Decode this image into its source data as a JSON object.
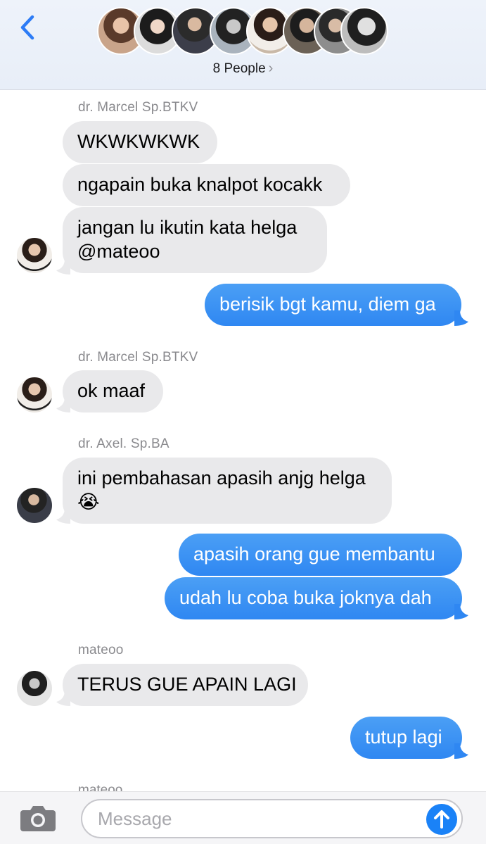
{
  "header": {
    "group_label": "8 People",
    "back_icon": "chevron-left-icon",
    "accent": "#2d7cf6"
  },
  "messages": [
    {
      "sender": "dr. Marcel Sp.BTKV",
      "direction": "in",
      "lines": [
        "WKWKWKWK"
      ]
    },
    {
      "direction": "in",
      "lines": [
        "ngapain buka knalpot kocakk"
      ]
    },
    {
      "direction": "in",
      "lines": [
        "jangan lu ikutin kata helga",
        "@mateoo"
      ]
    },
    {
      "direction": "out",
      "lines": [
        "berisik bgt kamu, diem ga"
      ]
    },
    {
      "sender": "dr. Marcel Sp.BTKV",
      "direction": "in",
      "lines": [
        "ok maaf"
      ]
    },
    {
      "sender": "dr. Axel. Sp.BA",
      "direction": "in",
      "lines": [
        "ini pembahasan apasih anjg helga",
        "😭"
      ]
    },
    {
      "direction": "out",
      "lines": [
        "apasih orang gue membantu"
      ]
    },
    {
      "direction": "out",
      "lines": [
        "udah lu coba buka joknya dah"
      ]
    },
    {
      "sender": "mateoo",
      "direction": "in",
      "lines": [
        "TERUS GUE APAIN LAGI"
      ]
    },
    {
      "direction": "out",
      "lines": [
        "tutup lagi"
      ]
    }
  ],
  "partial_sender": "mateoo",
  "input": {
    "placeholder": "Message",
    "camera_icon": "camera-icon",
    "send_icon": "arrow-up-icon"
  },
  "colors": {
    "incoming_bubble": "#e9e9eb",
    "outgoing_bubble": "#2f87f2",
    "sender_name": "#8a8a8e"
  }
}
